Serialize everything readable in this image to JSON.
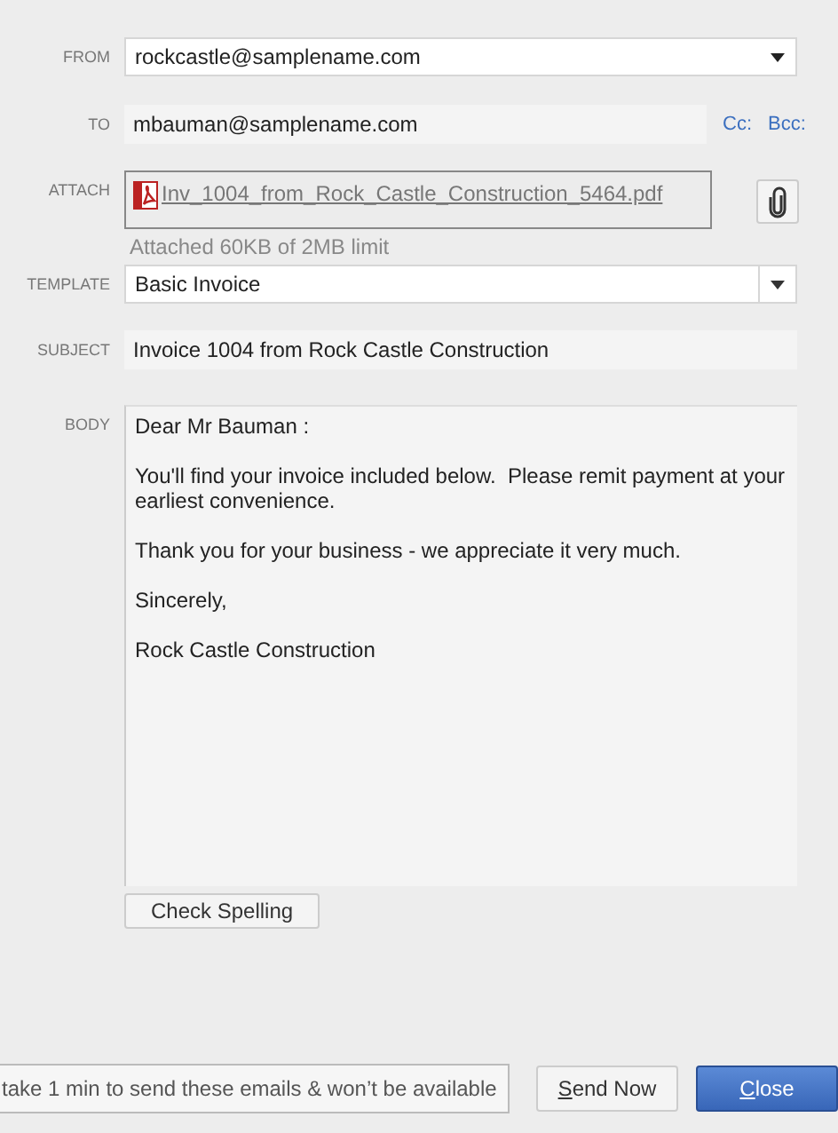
{
  "from": {
    "label": "FROM",
    "value": "rockcastle@samplename.com"
  },
  "to": {
    "label": "TO",
    "value": "mbauman@samplename.com",
    "links": [
      "Cc:",
      "Bcc:"
    ]
  },
  "attach": {
    "label": "ATTACH",
    "file": "Inv_1004_from_Rock_Castle_Construction_5464.pdf",
    "note": "Attached 60KB of 2MB limit"
  },
  "template": {
    "label": "TEMPLATE",
    "value": "Basic Invoice"
  },
  "subject": {
    "label": "SUBJECT",
    "value": "Invoice 1004 from Rock Castle Construction"
  },
  "body": {
    "label": "BODY",
    "paragraphs": [
      "Dear Mr Bauman :",
      "You'll find your invoice included below.  Please remit payment at your earliest convenience.",
      "Thank you for your business - we appreciate it very much.",
      "Sincerely,",
      "Rock Castle Construction"
    ]
  },
  "check_spelling": "Check Spelling",
  "status_message": "take 1 min to send these emails & won’t be available",
  "buttons": [
    {
      "label": "Send Now",
      "kind": "secondary"
    },
    {
      "label": "Close",
      "kind": "primary"
    }
  ]
}
